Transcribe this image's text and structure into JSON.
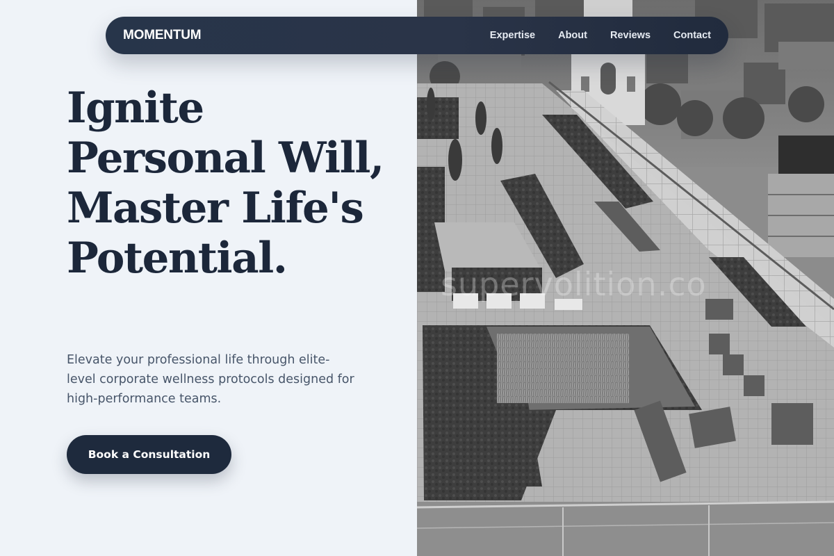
{
  "nav": {
    "brand": "MOMENTUM",
    "links": [
      {
        "label": "Expertise"
      },
      {
        "label": "About"
      },
      {
        "label": "Reviews"
      },
      {
        "label": "Contact"
      }
    ]
  },
  "hero": {
    "title": "Ignite Personal Will, Master Life's Potential.",
    "subtitle": "Elevate your professional life through elite-level corporate wellness protocols designed for high-performance teams.",
    "cta_label": "Book a Consultation"
  },
  "image": {
    "watermark": "supervolition.co"
  },
  "colors": {
    "page_bg": "#eff3f8",
    "nav_bg": "#27354a",
    "title": "#1c273a",
    "subtitle": "#475569",
    "cta_bg": "#1e2a3d"
  }
}
